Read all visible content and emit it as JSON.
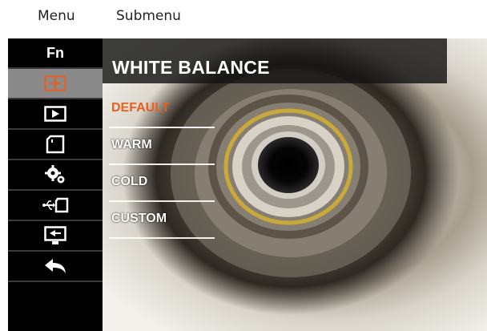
{
  "captions": {
    "menu": "Menu",
    "submenu": "Submenu"
  },
  "sidebar": {
    "fn_label": "Fn",
    "items": [
      {
        "icon": "white-balance-icon",
        "active": true
      },
      {
        "icon": "playback-icon",
        "active": false
      },
      {
        "icon": "sd-card-icon",
        "active": false
      },
      {
        "icon": "settings-gears-icon",
        "active": false
      },
      {
        "icon": "usb-connection-icon",
        "active": false
      },
      {
        "icon": "video-output-icon",
        "active": false
      },
      {
        "icon": "back-arrow-icon",
        "active": false
      }
    ]
  },
  "submenu": {
    "title": "WHITE BALANCE",
    "options": [
      {
        "label": "DEFAULT",
        "selected": true
      },
      {
        "label": "WARM",
        "selected": false
      },
      {
        "label": "COLD",
        "selected": false
      },
      {
        "label": "CUSTOM",
        "selected": false
      }
    ]
  },
  "colors": {
    "accent": "#e8601c",
    "sidebar_bg": "#000000",
    "active_item_bg": "#8a8a8a",
    "text": "#ffffff"
  }
}
